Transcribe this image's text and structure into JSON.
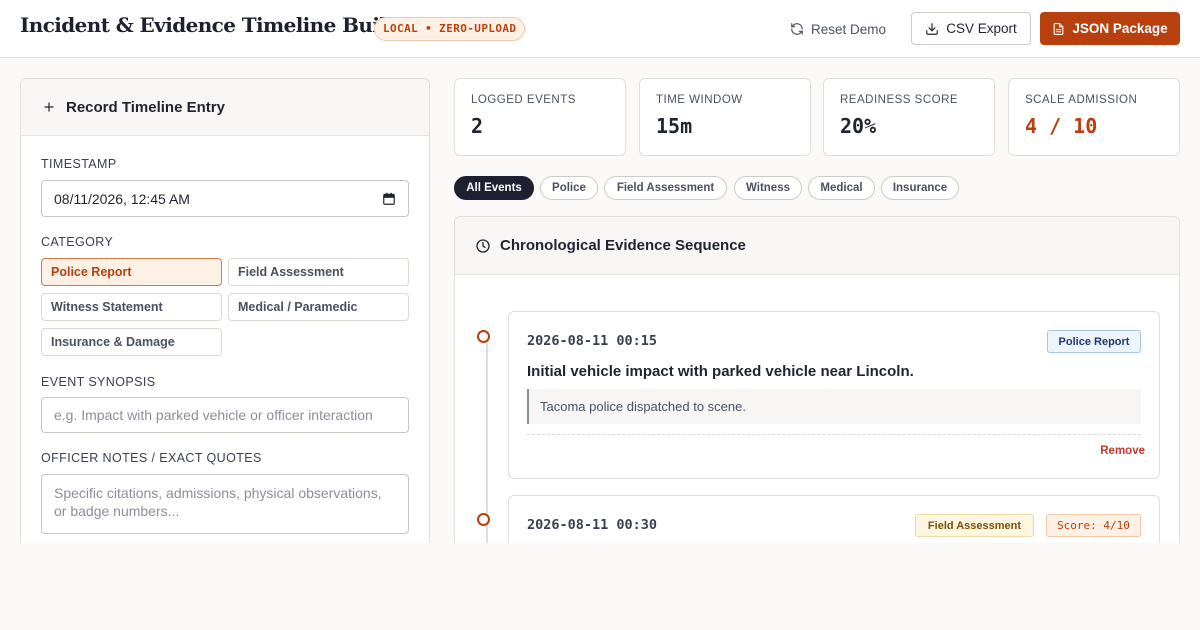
{
  "header": {
    "title": "Incident & Evidence Timeline Builder",
    "badge": "LOCAL • ZERO-UPLOAD",
    "reset_label": "Reset Demo",
    "csv_label": "CSV Export",
    "json_label": "JSON Package"
  },
  "entry_form": {
    "heading": "Record Timeline Entry",
    "timestamp_label": "TIMESTAMP",
    "timestamp_value": "08/11/2026, 12:45 AM",
    "category_label": "CATEGORY",
    "categories": [
      {
        "label": "Police Report",
        "selected": true
      },
      {
        "label": "Field Assessment",
        "selected": false
      },
      {
        "label": "Witness Statement",
        "selected": false
      },
      {
        "label": "Medical / Paramedic",
        "selected": false
      },
      {
        "label": "Insurance & Damage",
        "selected": false
      }
    ],
    "synopsis_label": "EVENT SYNOPSIS",
    "synopsis_placeholder": "e.g. Impact with parked vehicle or officer interaction",
    "notes_label": "OFFICER NOTES / EXACT QUOTES",
    "notes_placeholder": "Specific citations, admissions, physical observations, or badge numbers..."
  },
  "stats": [
    {
      "label": "LOGGED EVENTS",
      "value": "2",
      "accent": false
    },
    {
      "label": "TIME WINDOW",
      "value": "15m",
      "accent": false
    },
    {
      "label": "READINESS SCORE",
      "value": "20%",
      "accent": false
    },
    {
      "label": "SCALE ADMISSION",
      "value": "4 / 10",
      "accent": true
    }
  ],
  "filters": [
    {
      "label": "All Events",
      "active": true
    },
    {
      "label": "Police",
      "active": false
    },
    {
      "label": "Field Assessment",
      "active": false
    },
    {
      "label": "Witness",
      "active": false
    },
    {
      "label": "Medical",
      "active": false
    },
    {
      "label": "Insurance",
      "active": false
    }
  ],
  "sequence": {
    "heading": "Chronological Evidence Sequence",
    "events": [
      {
        "timestamp": "2026-08-11 00:15",
        "category": "Police Report",
        "title": "Initial vehicle impact with parked vehicle near Lincoln.",
        "note": "Tacoma police dispatched to scene.",
        "remove_label": "Remove"
      },
      {
        "timestamp": "2026-08-11 00:30",
        "category": "Field Assessment",
        "score": "Score: 4/10"
      }
    ]
  },
  "colors": {
    "accent": "#b8400e",
    "dark": "#1c2030",
    "police_tag": "#1e3a6e",
    "field_tag": "#7a5200"
  },
  "icons": [
    "plus-icon",
    "refresh-icon",
    "download-icon",
    "file-icon",
    "calendar-icon",
    "clock-icon"
  ]
}
